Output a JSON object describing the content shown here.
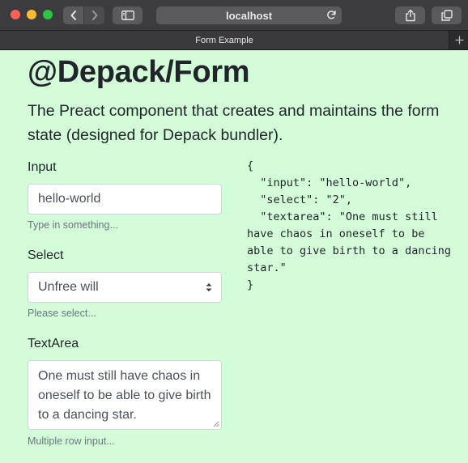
{
  "browser": {
    "url": "localhost",
    "tab_title": "Form Example"
  },
  "page": {
    "title": "@Depack/Form",
    "lead": "The Preact component that creates and maintains the form state (designed for Depack bundler)."
  },
  "form": {
    "input": {
      "label": "Input",
      "value": "hello-world",
      "help": "Type in something..."
    },
    "select": {
      "label": "Select",
      "value": "Unfree will",
      "help": "Please select..."
    },
    "textarea": {
      "label": "TextArea",
      "value": "One must still have chaos in oneself to be able to give birth to a dancing star.",
      "help": "Multiple row input..."
    }
  },
  "state_json": "{\n  \"input\": \"hello-world\",\n  \"select\": \"2\",\n  \"textarea\": \"One must still have chaos in oneself to be able to give birth to a dancing star.\"\n}",
  "icons": {
    "back": "chevron-left-icon",
    "forward": "chevron-right-icon",
    "sidebar": "sidebar-icon",
    "reload": "reload-icon",
    "share": "share-icon",
    "tabs": "tabs-overview-icon",
    "new_tab": "plus-icon",
    "select_caret": "up-down-caret-icon"
  },
  "colors": {
    "page_background": "#d3fdd8",
    "toolbar": "#3c3b3d",
    "close": "#fe5f57",
    "minimize": "#febc2e",
    "zoom": "#28c840"
  }
}
